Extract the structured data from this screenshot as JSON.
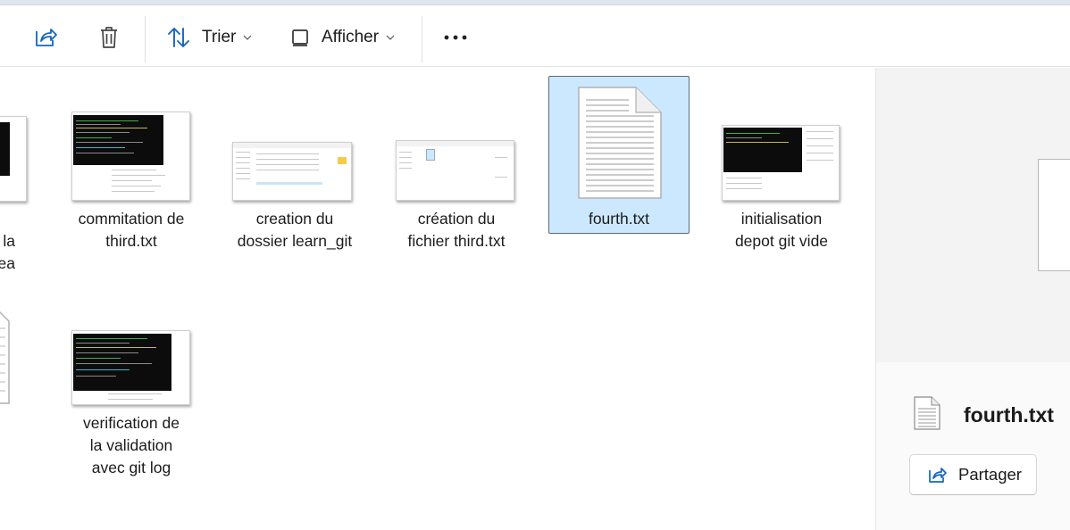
{
  "toolbar": {
    "sort_label": "Trier",
    "view_label": "Afficher",
    "more_label": "•••"
  },
  "files": [
    {
      "name_line1": "la",
      "name_line2": "ea"
    },
    {
      "name_line1": "commitation de",
      "name_line2": "third.txt"
    },
    {
      "name_line1": "creation du",
      "name_line2": "dossier learn_git"
    },
    {
      "name_line1": "création du",
      "name_line2": "fichier third.txt"
    },
    {
      "name": "fourth.txt"
    },
    {
      "name_line1": "initialisation",
      "name_line2": "depot git vide"
    },
    {
      "name_line1": "verification de",
      "name_line2": "la validation",
      "name_line3": "avec git log"
    }
  ],
  "details_pane": {
    "file_name": "fourth.txt",
    "share_label": "Partager"
  }
}
